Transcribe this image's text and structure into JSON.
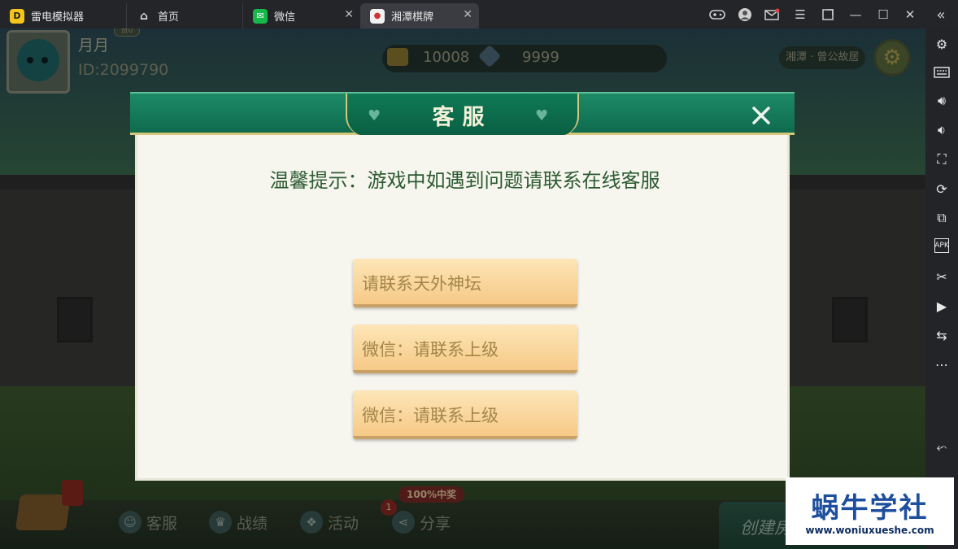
{
  "titlebar": {
    "tabs": [
      {
        "label": "雷电模拟器",
        "icon": "leidian-logo-icon"
      },
      {
        "label": "首页",
        "icon": "home-icon"
      },
      {
        "label": "微信",
        "icon": "wechat-icon"
      },
      {
        "label": "湘潭棋牌",
        "icon": "mahjong-tile-icon"
      }
    ],
    "window_controls": [
      "gamepad-icon",
      "account-icon",
      "mail-icon",
      "menu-icon",
      "popout-icon",
      "minimize-icon",
      "maximize-icon",
      "close-icon",
      "collapse-sidebar-icon"
    ]
  },
  "sidebar": {
    "items": [
      "settings-icon",
      "keyboard-icon",
      "volume-up-icon",
      "volume-down-icon",
      "screenshot-icon",
      "rotate-icon",
      "multi-instance-icon",
      "apk-install-icon",
      "scissors-icon",
      "record-icon",
      "sync-icon",
      "more-icon",
      "back-icon"
    ]
  },
  "player": {
    "nickname": "月月",
    "id_text": "ID:2099790",
    "vip_text": "贵0"
  },
  "currency": {
    "gold": "10008",
    "diamond": "9999"
  },
  "location": "湘潭 · 曾公故居",
  "bottom_bar": {
    "items": [
      "客服",
      "战绩",
      "活动",
      "分享"
    ],
    "promo": "100%中奖",
    "share_badge": "1",
    "create_room": "创建房"
  },
  "dialog": {
    "title": "客服",
    "notice": "温馨提示：游戏中如遇到问题请联系在线客服",
    "buttons": [
      "请联系天外神坛",
      "微信：请联系上级",
      "微信：请联系上级"
    ]
  },
  "watermark": {
    "title": "蜗牛学社",
    "url": "www.woniuxueshe.com"
  },
  "colors": {
    "dialog_header": "#1d8a66",
    "dialog_body": "#f6f5ee",
    "button_fill": "#f6c987",
    "notice_text": "#2c5b32"
  }
}
